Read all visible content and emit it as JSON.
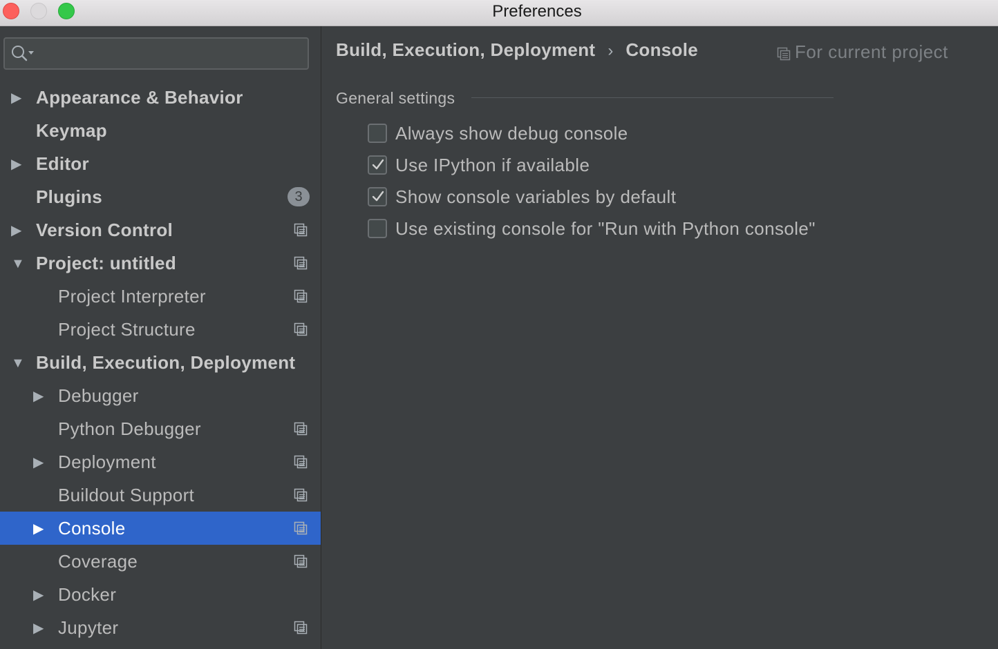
{
  "window": {
    "title": "Preferences"
  },
  "search": {
    "placeholder": "",
    "value": ""
  },
  "sidebar": {
    "items": [
      {
        "label": "Appearance & Behavior",
        "level": 0,
        "bold": true,
        "arrow": "collapsed",
        "project_icon": false
      },
      {
        "label": "Keymap",
        "level": 0,
        "bold": true,
        "arrow": "none",
        "project_icon": false
      },
      {
        "label": "Editor",
        "level": 0,
        "bold": true,
        "arrow": "collapsed",
        "project_icon": false
      },
      {
        "label": "Plugins",
        "level": 0,
        "bold": true,
        "arrow": "none",
        "project_icon": false,
        "badge": "3"
      },
      {
        "label": "Version Control",
        "level": 0,
        "bold": true,
        "arrow": "collapsed",
        "project_icon": true
      },
      {
        "label": "Project: untitled",
        "level": 0,
        "bold": true,
        "arrow": "expanded",
        "project_icon": true
      },
      {
        "label": "Project Interpreter",
        "level": 1,
        "bold": false,
        "arrow": "none",
        "project_icon": true
      },
      {
        "label": "Project Structure",
        "level": 1,
        "bold": false,
        "arrow": "none",
        "project_icon": true
      },
      {
        "label": "Build, Execution, Deployment",
        "level": 0,
        "bold": true,
        "arrow": "expanded",
        "project_icon": false
      },
      {
        "label": "Debugger",
        "level": 1,
        "bold": false,
        "arrow": "collapsed",
        "project_icon": false
      },
      {
        "label": "Python Debugger",
        "level": 1,
        "bold": false,
        "arrow": "none",
        "project_icon": true
      },
      {
        "label": "Deployment",
        "level": 1,
        "bold": false,
        "arrow": "collapsed",
        "project_icon": true
      },
      {
        "label": "Buildout Support",
        "level": 1,
        "bold": false,
        "arrow": "none",
        "project_icon": true
      },
      {
        "label": "Console",
        "level": 1,
        "bold": false,
        "arrow": "collapsed",
        "project_icon": true,
        "selected": true
      },
      {
        "label": "Coverage",
        "level": 1,
        "bold": false,
        "arrow": "none",
        "project_icon": true
      },
      {
        "label": "Docker",
        "level": 1,
        "bold": false,
        "arrow": "collapsed",
        "project_icon": false
      },
      {
        "label": "Jupyter",
        "level": 1,
        "bold": false,
        "arrow": "collapsed",
        "project_icon": true
      }
    ]
  },
  "breadcrumb": {
    "parent": "Build, Execution, Deployment",
    "separator": "›",
    "current": "Console"
  },
  "scope": {
    "label": "For current project",
    "icon": "project-scope-icon"
  },
  "section": {
    "title": "General settings"
  },
  "options": [
    {
      "label": "Always show debug console",
      "checked": false
    },
    {
      "label": "Use IPython if available",
      "checked": true
    },
    {
      "label": "Show console variables by default",
      "checked": true
    },
    {
      "label": "Use existing console for \"Run with Python console\"",
      "checked": false
    }
  ],
  "colors": {
    "selection": "#2f65ca",
    "background": "#3c3f41",
    "text": "#bbbbbb",
    "muted": "#7d8185"
  }
}
